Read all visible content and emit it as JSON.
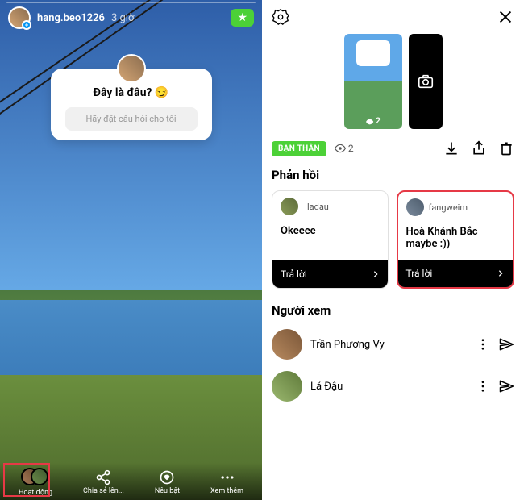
{
  "story": {
    "username": "hang.beo1226",
    "time": "3 giờ",
    "question": "Đây là đâu? 😏",
    "placeholder": "Hãy đặt câu hỏi cho tôi",
    "bottom_items": [
      "Hoạt động",
      "Chia sẻ lên...",
      "Nêu bật",
      "Xem thêm"
    ]
  },
  "insights": {
    "close_badge": "BẠN THÂN",
    "view_count": "2",
    "responses_title": "Phản hồi",
    "viewers_title": "Người xem",
    "reply_label": "Trả lời",
    "responses": [
      {
        "name": "_ladau",
        "body": "Okeeee"
      },
      {
        "name": "fangweim",
        "body": "Hoà Khánh Bắc maybe :))"
      }
    ],
    "viewers": [
      {
        "name": "Trần Phương Vy"
      },
      {
        "name": "Lá Đậu"
      }
    ]
  }
}
